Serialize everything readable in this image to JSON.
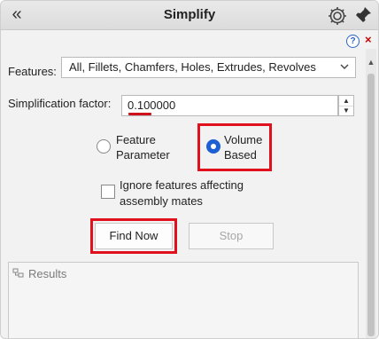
{
  "header": {
    "title": "Simplify",
    "collapse_glyph": "«",
    "gear_icon": "gear-icon",
    "pin_icon": "pin-icon"
  },
  "help": {
    "help_glyph": "?",
    "close_glyph": "×"
  },
  "features": {
    "label": "Features:",
    "value": "All, Fillets, Chamfers, Holes, Extrudes, Revolves"
  },
  "factor": {
    "label": "Simplification factor:",
    "value": "0.100000"
  },
  "method": {
    "options": [
      {
        "label_line1": "Feature",
        "label_line2": "Parameter",
        "selected": false
      },
      {
        "label_line1": "Volume",
        "label_line2": "Based",
        "selected": true
      }
    ]
  },
  "ignore_option": {
    "label_line1": "Ignore features affecting",
    "label_line2": "assembly mates",
    "checked": false
  },
  "buttons": {
    "find_now": "Find Now",
    "stop": "Stop"
  },
  "results": {
    "label": "Results"
  },
  "colors": {
    "highlight": "#e0101d",
    "radio_selected": "#1e5fd3"
  }
}
